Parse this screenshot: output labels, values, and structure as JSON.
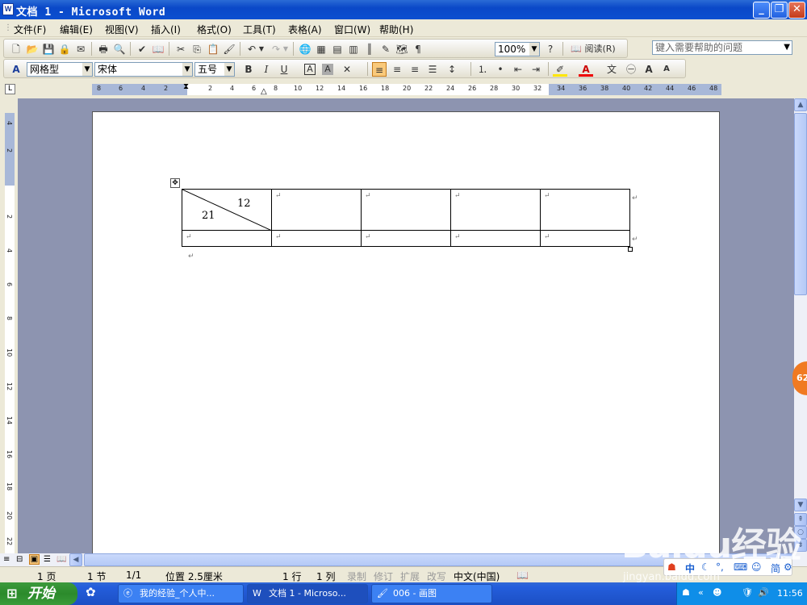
{
  "window": {
    "title": "文档 1 - Microsoft Word",
    "icon_label": "W"
  },
  "menu": [
    "文件(F)",
    "编辑(E)",
    "视图(V)",
    "插入(I)",
    "格式(O)",
    "工具(T)",
    "表格(A)",
    "窗口(W)",
    "帮助(H)"
  ],
  "help_placeholder": "键入需要帮助的问题",
  "toolbar": {
    "zoom": "100%",
    "read_label": "阅读(R)"
  },
  "format": {
    "style": "网格型",
    "font": "宋体",
    "size": "五号"
  },
  "ruler": {
    "numbers": [
      "8",
      "6",
      "4",
      "2",
      "2",
      "2",
      "4",
      "6",
      "8",
      "10",
      "12",
      "14",
      "16",
      "18",
      "20",
      "22",
      "24",
      "26",
      "28",
      "30",
      "32",
      "34",
      "36",
      "38",
      "40",
      "42",
      "44",
      "46",
      "48"
    ]
  },
  "vruler": {
    "numbers": [
      "4",
      "2",
      "2",
      "2",
      "4",
      "6",
      "8",
      "10",
      "12",
      "14",
      "16",
      "18",
      "20",
      "22"
    ]
  },
  "table": {
    "cell_top": "12",
    "cell_bottom": "21",
    "return_mark": "↵"
  },
  "status": {
    "page": "1 页",
    "section": "1 节",
    "pages": "1/1",
    "position": "位置 2.5厘米",
    "line": "1 行",
    "column": "1 列",
    "rec": "录制",
    "trk": "修订",
    "ext": "扩展",
    "ovr": "改写",
    "lang": "中文(中国)"
  },
  "taskbar": {
    "start": "开始",
    "tasks": [
      "我的经验_个人中...",
      "文档 1 - Microso...",
      "006 - 画图"
    ],
    "clock": "11:56"
  },
  "ime": {
    "label": "中",
    "simp": "简"
  },
  "badge": "62",
  "watermark": {
    "logo": "Baidu经验",
    "url": "jingyan.baidu.com"
  }
}
